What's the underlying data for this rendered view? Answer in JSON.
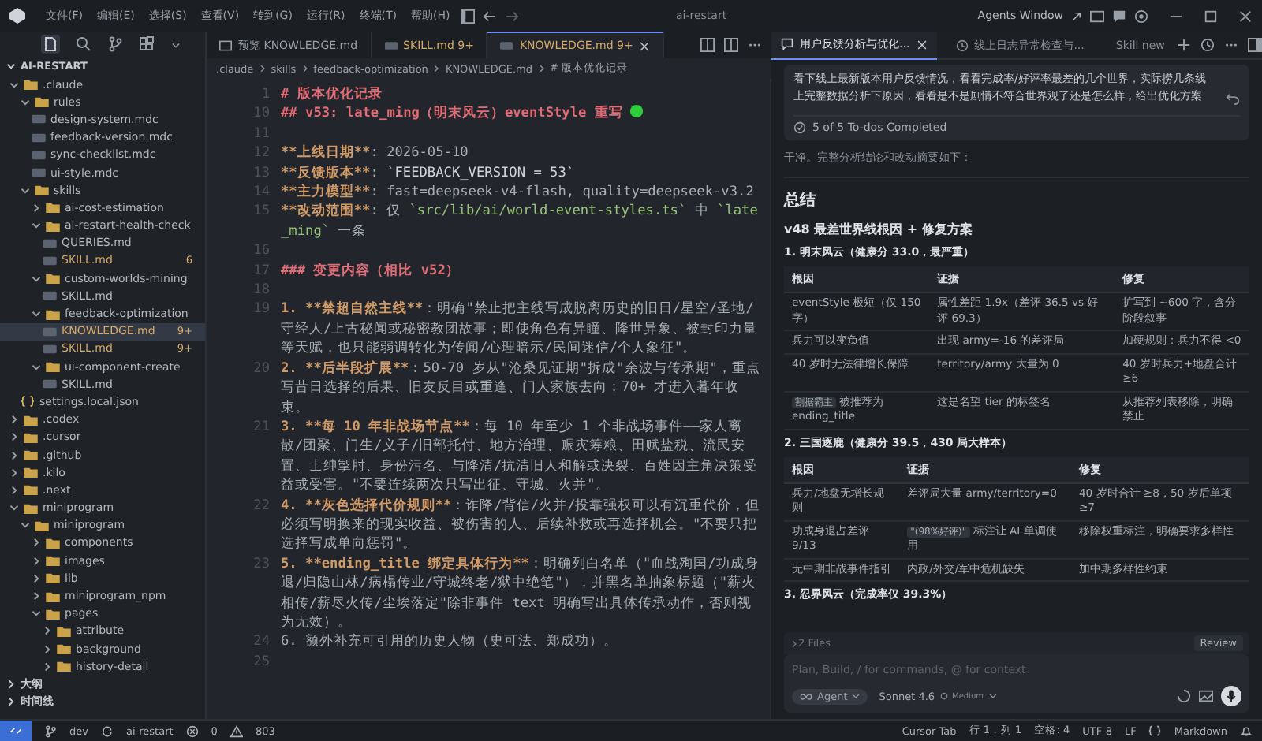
{
  "menu_bar": {
    "items": [
      "文件(F)",
      "编辑(E)",
      "选择(S)",
      "查看(V)",
      "转到(G)",
      "运行(R)",
      "终端(T)",
      "帮助(H)"
    ],
    "title": "ai-restart",
    "agents_window": "Agents Window"
  },
  "explorer": {
    "root": "AI-RESTART",
    "tree": [
      {
        "label": ".claude",
        "kind": "folder",
        "expanded": true,
        "selected": false,
        "children": [
          {
            "label": "rules",
            "kind": "folder",
            "expanded": true,
            "selected": false,
            "children": [
              {
                "label": "design-system.mdc",
                "kind": "file",
                "selected": false
              },
              {
                "label": "feedback-version.mdc",
                "kind": "file",
                "selected": false
              },
              {
                "label": "sync-checklist.mdc",
                "kind": "file",
                "selected": false
              },
              {
                "label": "ui-style.mdc",
                "kind": "file",
                "selected": false
              }
            ]
          },
          {
            "label": "skills",
            "kind": "folder",
            "expanded": true,
            "selected": false,
            "children": [
              {
                "label": "ai-cost-estimation",
                "kind": "folder",
                "expanded": false,
                "selected": false
              },
              {
                "label": "ai-restart-health-check",
                "kind": "folder",
                "expanded": true,
                "selected": false,
                "children": [
                  {
                    "label": "QUERIES.md",
                    "kind": "file",
                    "selected": false
                  },
                  {
                    "label": "SKILL.md",
                    "kind": "file",
                    "selected": false,
                    "badge": "6"
                  }
                ]
              },
              {
                "label": "custom-worlds-mining",
                "kind": "folder",
                "expanded": true,
                "selected": false,
                "children": [
                  {
                    "label": "SKILL.md",
                    "kind": "file",
                    "selected": false
                  }
                ]
              },
              {
                "label": "feedback-optimization",
                "kind": "folder",
                "expanded": true,
                "selected": false,
                "children": [
                  {
                    "label": "KNOWLEDGE.md",
                    "kind": "file",
                    "selected": true,
                    "badge": "9+"
                  },
                  {
                    "label": "SKILL.md",
                    "kind": "file",
                    "selected": false,
                    "badge": "9+"
                  }
                ]
              },
              {
                "label": "ui-component-create",
                "kind": "folder",
                "expanded": true,
                "selected": false,
                "children": [
                  {
                    "label": "SKILL.md",
                    "kind": "file",
                    "selected": false
                  }
                ]
              }
            ]
          },
          {
            "label": "settings.local.json",
            "kind": "json",
            "selected": false
          }
        ]
      },
      {
        "label": ".codex",
        "kind": "folder",
        "expanded": false,
        "selected": false
      },
      {
        "label": ".cursor",
        "kind": "folder",
        "expanded": false,
        "selected": false
      },
      {
        "label": ".github",
        "kind": "folder",
        "expanded": false,
        "selected": false
      },
      {
        "label": ".kilo",
        "kind": "folder",
        "expanded": false,
        "selected": false
      },
      {
        "label": ".next",
        "kind": "folder",
        "expanded": false,
        "selected": false
      },
      {
        "label": "miniprogram",
        "kind": "folder",
        "expanded": true,
        "selected": false,
        "children": [
          {
            "label": "miniprogram",
            "kind": "folder",
            "expanded": true,
            "selected": false,
            "children": [
              {
                "label": "components",
                "kind": "folder",
                "expanded": false,
                "selected": false
              },
              {
                "label": "images",
                "kind": "folder",
                "expanded": false,
                "selected": false
              },
              {
                "label": "lib",
                "kind": "folder",
                "expanded": false,
                "selected": false
              },
              {
                "label": "miniprogram_npm",
                "kind": "folder",
                "expanded": false,
                "selected": false
              },
              {
                "label": "pages",
                "kind": "folder",
                "expanded": true,
                "selected": false,
                "children": [
                  {
                    "label": "attribute",
                    "kind": "folder",
                    "expanded": false,
                    "selected": false
                  },
                  {
                    "label": "background",
                    "kind": "folder",
                    "expanded": false,
                    "selected": false
                  },
                  {
                    "label": "history-detail",
                    "kind": "folder",
                    "expanded": false,
                    "selected": false
                  }
                ]
              }
            ]
          }
        ]
      }
    ],
    "sections": [
      "大纲",
      "时间线"
    ]
  },
  "editor": {
    "tabs": [
      {
        "label": "预览 KNOWLEDGE.md",
        "kind": "preview",
        "selected": false
      },
      {
        "label": "SKILL.md",
        "badge": "9+",
        "kind": "file",
        "selected": false
      },
      {
        "label": "KNOWLEDGE.md",
        "badge": "9+",
        "kind": "file",
        "selected": true
      }
    ],
    "breadcrumb": [
      ".claude",
      "skills",
      "feedback-optimization",
      "KNOWLEDGE.md",
      "# 版本优化记录"
    ],
    "lines": [
      {
        "number": "1",
        "segments": [
          {
            "kind": "heading",
            "text": "# 版本优化记录"
          }
        ]
      },
      {
        "number": "10",
        "segments": [
          {
            "kind": "heading",
            "text": "## v53: late_ming（明末风云）eventStyle 重写"
          },
          {
            "kind": "dot"
          }
        ]
      },
      {
        "number": "11"
      },
      {
        "number": "12",
        "segments": [
          {
            "kind": "bold",
            "text": "**上线日期**"
          },
          {
            "kind": "text",
            "text": ": 2026-05-10"
          }
        ]
      },
      {
        "number": "13",
        "segments": [
          {
            "kind": "bold",
            "text": "**反馈版本**"
          },
          {
            "kind": "text",
            "text": ": "
          },
          {
            "kind": "code",
            "text": "`FEEDBACK_VERSION = 53`"
          }
        ]
      },
      {
        "number": "14",
        "segments": [
          {
            "kind": "bold",
            "text": "**主力模型**"
          },
          {
            "kind": "text",
            "text": ": fast=deepseek-v4-flash, quality=deepseek-v3.2"
          }
        ]
      },
      {
        "number": "15",
        "segments": [
          {
            "kind": "bold",
            "text": "**改动范围**"
          },
          {
            "kind": "text",
            "text": ": 仅 "
          },
          {
            "kind": "path",
            "text": "`src/lib/ai/world-event-styles.ts`"
          },
          {
            "kind": "text",
            "text": " 中 "
          },
          {
            "kind": "path",
            "text": "`late_ming`"
          },
          {
            "kind": "text",
            "text": " 一条"
          }
        ]
      },
      {
        "number": "16"
      },
      {
        "number": "17",
        "segments": [
          {
            "kind": "heading",
            "text": "### 变更内容（相比 v52）"
          }
        ]
      },
      {
        "number": "18"
      },
      {
        "number": "19",
        "segments": [
          {
            "kind": "bold",
            "text": "1. **禁超自然主线**"
          },
          {
            "kind": "text",
            "text": "：明确\"禁止把主线写成脱离历史的旧日/星空/圣地/守经人/上古秘闻或秘密教团故事；即使角色有异瞳、降世异象、被封印力量等天赋，也只能弱调转化为传闻/心理暗示/民间迷信/个人象征\"。"
          }
        ]
      },
      {
        "number": "20",
        "segments": [
          {
            "kind": "bold",
            "text": "2. **后半段扩展**"
          },
          {
            "kind": "text",
            "text": "：50-70 岁从\"沧桑见证期\"拆成\"余波与传承期\"，重点写昔日选择的后果、旧友反目或重逢、门人家族去向；70+ 才进入暮年收束。"
          }
        ]
      },
      {
        "number": "21",
        "segments": [
          {
            "kind": "bold",
            "text": "3. **每 10 年非战场节点**"
          },
          {
            "kind": "text",
            "text": "：每 10 年至少 1 个非战场事件——家人离散/团聚、门生/义子/旧部托付、地方治理、赈灾筹粮、田赋盐税、流民安置、士绅掣肘、身份污名、与降清/抗清旧人和解或决裂、百姓因主角决策受益或受害。\"不要连续两次只写出征、守城、火并\"。"
          }
        ]
      },
      {
        "number": "22",
        "segments": [
          {
            "kind": "bold",
            "text": "4. **灰色选择代价规则**"
          },
          {
            "kind": "text",
            "text": "：诈降/背信/火并/投靠强权可以有沉重代价，但必须写明换来的现实收益、被伤害的人、后续补救或再选择机会。\"不要只把选择写成单向惩罚\"。"
          }
        ]
      },
      {
        "number": "23",
        "segments": [
          {
            "kind": "bold",
            "text": "5. **ending_title 绑定具体行为**"
          },
          {
            "kind": "text",
            "text": "：明确列白名单（\"血战殉国/功成身退/归隐山林/病榻传业/守城终老/狱中绝笔\"），并黑名单抽象标题（\"薪火相传/薪尽火传/尘埃落定\"除非事件 text 明确写出具体传承动作，否则视为无效）。"
          }
        ]
      },
      {
        "number": "24",
        "segments": [
          {
            "kind": "text",
            "text": "6. 额外补充可引用的历史人物（史可法、郑成功）。"
          }
        ]
      },
      {
        "number": "25"
      }
    ]
  },
  "agent_panel": {
    "tabs": [
      {
        "label": "用户反馈分析与优化...",
        "selected": true
      },
      {
        "label": "线上日志异常检查与...",
        "selected": false
      }
    ],
    "new_button": "Skill new",
    "prompt": "看下线上最新版本用户反馈情况，看看完成率/好评率最差的几个世界，实际捞几条线上完整数据分析下原因，看看是不是剧情不符合世界观了还是怎么样，给出优化方案",
    "todos": "5 of 5 To-dos Completed",
    "blocks": [
      {
        "kind": "paragraph",
        "text": "干净。完整分析结论和改动摘要如下："
      },
      {
        "kind": "divider"
      },
      {
        "kind": "h1",
        "text": "总结"
      },
      {
        "kind": "h2",
        "text": "v48 最差世界线根因 + 修复方案"
      },
      {
        "kind": "h3",
        "text": "1. 明末风云（健康分 33.0，最严重）"
      },
      {
        "kind": "table",
        "columns": [
          "根因",
          "证据",
          "修复"
        ],
        "rows": [
          [
            "eventStyle 极短（仅 150 字）",
            "属性差距 1.9x（差评 36.5 vs 好评 69.3）",
            "扩写到 ~600 字，含分阶段叙事"
          ],
          [
            "兵力可以变负值",
            "出现 army=-16 的差评局",
            "加硬规则：兵力不得 <0"
          ],
          [
            "40 岁时无法律增长保障",
            "territory/army 大量为 0",
            "40 岁时兵力+地盘合计 ≥6"
          ],
          [
            {
              "code": "割据霸主",
              "text": " 被推荐为 ending_title"
            },
            "这是名望 tier 的标签名",
            "从推荐列表移除，明确禁止"
          ]
        ]
      },
      {
        "kind": "h3",
        "text": "2. **三国逐鹿（健康分** 39.5**，430 局大样本）**"
      },
      {
        "kind": "table",
        "columns": [
          "根因",
          "证据",
          "修复"
        ],
        "rows": [
          [
            "兵力/地盘无增长规则",
            "差评局大量 army/territory=0",
            "40 岁时合计 ≥8，50 岁后单项 ≥7"
          ],
          [
            "功成身退占差评 9/13",
            {
              "code": "\"(98%好评)\"",
              "text": " 标注让 AI 单调使用"
            },
            "移除权重标注，明确要求多样性"
          ],
          [
            "无中期非战事件指引",
            "内政/外交/军中危机缺失",
            "加中期多样性约束"
          ]
        ]
      },
      {
        "kind": "h3",
        "text": "3. **忍界风云（完成率仅** 39.3%**）**"
      }
    ],
    "files": "2 Files",
    "review": "Review",
    "input": {
      "placeholder": "Plan, Build, / for commands, @ for context"
    },
    "mode": "Agent",
    "model": "Sonnet 4.6",
    "effort": "Medium"
  },
  "status_bar": {
    "branch": "dev",
    "project": "ai-restart",
    "errors": "0",
    "warnings": "803",
    "right": [
      "Cursor Tab",
      "行 1，列 1",
      "空格: 4",
      "UTF-8",
      "LF"
    ],
    "language": "Markdown"
  }
}
